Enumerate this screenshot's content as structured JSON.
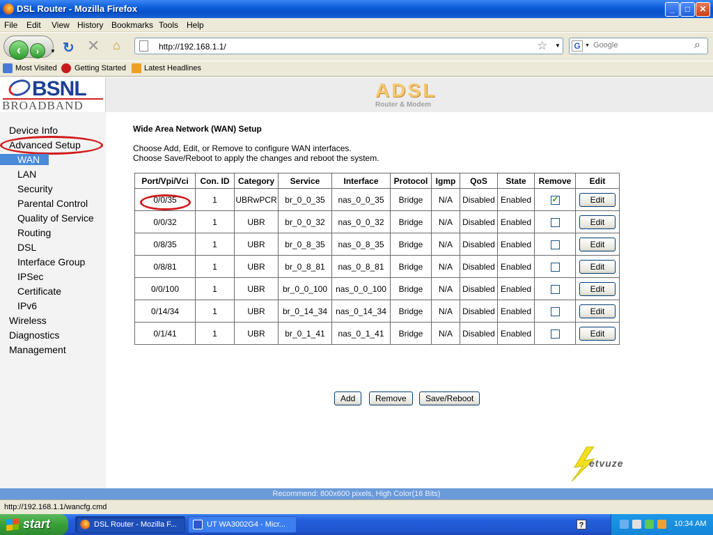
{
  "window": {
    "title": "DSL Router - Mozilla Firefox",
    "min_glyph": "_",
    "max_glyph": "□",
    "close_glyph": "✕"
  },
  "menu": [
    "File",
    "Edit",
    "View",
    "History",
    "Bookmarks",
    "Tools",
    "Help"
  ],
  "nav": {
    "url": "http://192.168.1.1/",
    "search_placeholder": "Google",
    "search_engine_glyph": "G"
  },
  "bookmarks": [
    "Most Visited",
    "Getting Started",
    "Latest Headlines"
  ],
  "logo": {
    "brand": "BSNL",
    "sub": "BROADBAND"
  },
  "banner": {
    "title": "ADSL",
    "subtitle": "Router & Modem"
  },
  "sidebar": {
    "items": [
      {
        "label": "Device Info"
      },
      {
        "label": "Advanced Setup"
      },
      {
        "label": "WAN"
      },
      {
        "label": "LAN"
      },
      {
        "label": "Security"
      },
      {
        "label": "Parental Control"
      },
      {
        "label": "Quality of Service"
      },
      {
        "label": "Routing"
      },
      {
        "label": "DSL"
      },
      {
        "label": "Interface Group"
      },
      {
        "label": "IPSec"
      },
      {
        "label": "Certificate"
      },
      {
        "label": "IPv6"
      },
      {
        "label": "Wireless"
      },
      {
        "label": "Diagnostics"
      },
      {
        "label": "Management"
      }
    ]
  },
  "main": {
    "heading": "Wide Area Network (WAN) Setup",
    "desc1": "Choose Add, Edit, or Remove to configure WAN interfaces.",
    "desc2": "Choose Save/Reboot to apply the changes and reboot the system.",
    "columns": [
      "Port/Vpi/Vci",
      "Con. ID",
      "Category",
      "Service",
      "Interface",
      "Protocol",
      "Igmp",
      "QoS",
      "State",
      "Remove",
      "Edit"
    ],
    "rows": [
      {
        "port": "0/0/35",
        "conid": "1",
        "category": "UBRwPCR",
        "service": "br_0_0_35",
        "iface": "nas_0_0_35",
        "protocol": "Bridge",
        "igmp": "N/A",
        "qos": "Disabled",
        "state": "Enabled",
        "remove": true,
        "edit": "Edit"
      },
      {
        "port": "0/0/32",
        "conid": "1",
        "category": "UBR",
        "service": "br_0_0_32",
        "iface": "nas_0_0_32",
        "protocol": "Bridge",
        "igmp": "N/A",
        "qos": "Disabled",
        "state": "Enabled",
        "remove": false,
        "edit": "Edit"
      },
      {
        "port": "0/8/35",
        "conid": "1",
        "category": "UBR",
        "service": "br_0_8_35",
        "iface": "nas_0_8_35",
        "protocol": "Bridge",
        "igmp": "N/A",
        "qos": "Disabled",
        "state": "Enabled",
        "remove": false,
        "edit": "Edit"
      },
      {
        "port": "0/8/81",
        "conid": "1",
        "category": "UBR",
        "service": "br_0_8_81",
        "iface": "nas_0_8_81",
        "protocol": "Bridge",
        "igmp": "N/A",
        "qos": "Disabled",
        "state": "Enabled",
        "remove": false,
        "edit": "Edit"
      },
      {
        "port": "0/0/100",
        "conid": "1",
        "category": "UBR",
        "service": "br_0_0_100",
        "iface": "nas_0_0_100",
        "protocol": "Bridge",
        "igmp": "N/A",
        "qos": "Disabled",
        "state": "Enabled",
        "remove": false,
        "edit": "Edit"
      },
      {
        "port": "0/14/34",
        "conid": "1",
        "category": "UBR",
        "service": "br_0_14_34",
        "iface": "nas_0_14_34",
        "protocol": "Bridge",
        "igmp": "N/A",
        "qos": "Disabled",
        "state": "Enabled",
        "remove": false,
        "edit": "Edit"
      },
      {
        "port": "0/1/41",
        "conid": "1",
        "category": "UBR",
        "service": "br_0_1_41",
        "iface": "nas_0_1_41",
        "protocol": "Bridge",
        "igmp": "N/A",
        "qos": "Disabled",
        "state": "Enabled",
        "remove": false,
        "edit": "Edit"
      }
    ],
    "add_label": "Add",
    "remove_label": "Remove",
    "save_reboot_label": "Save/Reboot"
  },
  "watermark": "etvuze",
  "recommend": "Recommend: 800x600 pixels, High Color(16 Bits)",
  "status_url": "http://192.168.1.1/wancfg.cmd",
  "taskbar": {
    "start": "start",
    "tasks": [
      "DSL Router - Mozilla F...",
      "UT WA3002G4 - Micr..."
    ],
    "help_glyph": "?",
    "clock": "10:34 AM"
  },
  "colors": {
    "highlight_oval": "#d01c1c",
    "sidebar_selected": "#4a8ad8",
    "brand_blue": "#1d3f94"
  }
}
